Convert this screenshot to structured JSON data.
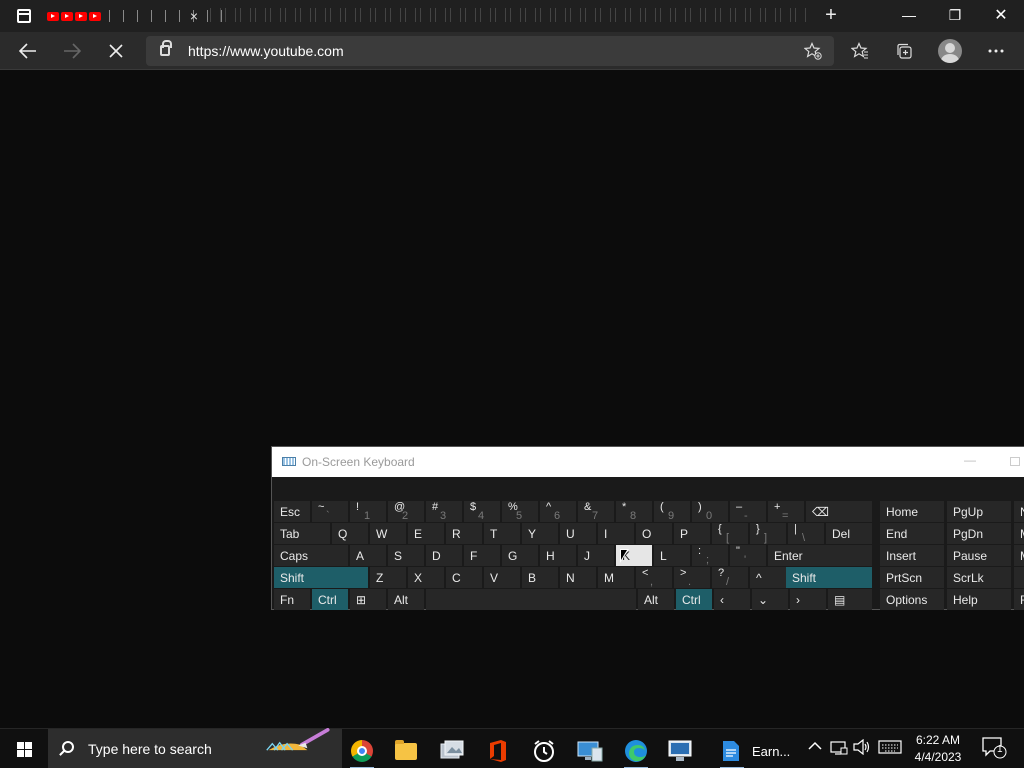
{
  "browser": {
    "url": "https://www.youtube.com",
    "tab_close_glyph": "×",
    "new_tab_glyph": "+",
    "icons": [
      "tab-actions-icon",
      "youtube-icon",
      "close-icon",
      "plus-icon",
      "back-icon",
      "forward-icon",
      "stop-loading-icon",
      "lock-icon",
      "add-favorite-icon",
      "favorites-icon",
      "collections-icon",
      "profile-avatar",
      "more-icon"
    ]
  },
  "window_controls": {
    "minimize": "—",
    "restore": "❐",
    "close": "✕"
  },
  "osk": {
    "title": "On-Screen Keyboard",
    "rows": [
      [
        {
          "id": "esc",
          "label": "Esc"
        },
        {
          "id": "tilde",
          "top": "~",
          "bot": "`"
        },
        {
          "id": "1",
          "top": "!",
          "bot": "1"
        },
        {
          "id": "2",
          "top": "@",
          "bot": "2"
        },
        {
          "id": "3",
          "top": "#",
          "bot": "3"
        },
        {
          "id": "4",
          "top": "$",
          "bot": "4"
        },
        {
          "id": "5",
          "top": "%",
          "bot": "5"
        },
        {
          "id": "6",
          "top": "^",
          "bot": "6"
        },
        {
          "id": "7",
          "top": "&",
          "bot": "7"
        },
        {
          "id": "8",
          "top": "*",
          "bot": "8"
        },
        {
          "id": "9",
          "top": "(",
          "bot": "9"
        },
        {
          "id": "0",
          "top": ")",
          "bot": "0"
        },
        {
          "id": "minus",
          "top": "–",
          "bot": "-"
        },
        {
          "id": "equals",
          "top": "+",
          "bot": "="
        },
        {
          "id": "backspace",
          "label": "⌫"
        }
      ],
      [
        {
          "id": "tab",
          "label": "Tab"
        },
        {
          "id": "q",
          "label": "Q"
        },
        {
          "id": "w",
          "label": "W"
        },
        {
          "id": "e",
          "label": "E"
        },
        {
          "id": "r",
          "label": "R"
        },
        {
          "id": "t",
          "label": "T"
        },
        {
          "id": "y",
          "label": "Y"
        },
        {
          "id": "u",
          "label": "U"
        },
        {
          "id": "i",
          "label": "I"
        },
        {
          "id": "o",
          "label": "O"
        },
        {
          "id": "p",
          "label": "P"
        },
        {
          "id": "lbrace",
          "top": "{",
          "bot": "["
        },
        {
          "id": "rbrace",
          "top": "}",
          "bot": "]"
        },
        {
          "id": "pipe",
          "top": "|",
          "bot": "\\"
        },
        {
          "id": "del",
          "label": "Del"
        }
      ],
      [
        {
          "id": "caps",
          "label": "Caps"
        },
        {
          "id": "a",
          "label": "A"
        },
        {
          "id": "s",
          "label": "S"
        },
        {
          "id": "d",
          "label": "D"
        },
        {
          "id": "f",
          "label": "F"
        },
        {
          "id": "g",
          "label": "G"
        },
        {
          "id": "h",
          "label": "H"
        },
        {
          "id": "j",
          "label": "J"
        },
        {
          "id": "k",
          "label": "K"
        },
        {
          "id": "l",
          "label": "L"
        },
        {
          "id": "colon",
          "top": ":",
          "bot": ";"
        },
        {
          "id": "quote",
          "top": "\"",
          "bot": "'"
        },
        {
          "id": "enter",
          "label": "Enter"
        }
      ],
      [
        {
          "id": "shift-left",
          "label": "Shift"
        },
        {
          "id": "z",
          "label": "Z"
        },
        {
          "id": "x",
          "label": "X"
        },
        {
          "id": "c",
          "label": "C"
        },
        {
          "id": "v",
          "label": "V"
        },
        {
          "id": "b",
          "label": "B"
        },
        {
          "id": "n",
          "label": "N"
        },
        {
          "id": "m",
          "label": "M"
        },
        {
          "id": "comma",
          "top": "<",
          "bot": ","
        },
        {
          "id": "period",
          "top": ">",
          "bot": "."
        },
        {
          "id": "slash",
          "top": "?",
          "bot": "/"
        },
        {
          "id": "up",
          "label": "^"
        },
        {
          "id": "shift-right",
          "label": "Shift"
        }
      ],
      [
        {
          "id": "fn",
          "label": "Fn"
        },
        {
          "id": "ctrl-left",
          "label": "Ctrl"
        },
        {
          "id": "win",
          "label": "⊞"
        },
        {
          "id": "alt-left",
          "label": "Alt"
        },
        {
          "id": "space",
          "label": ""
        },
        {
          "id": "alt-right",
          "label": "Alt"
        },
        {
          "id": "ctrl-right",
          "label": "Ctrl"
        },
        {
          "id": "left",
          "label": "‹"
        },
        {
          "id": "down",
          "label": "⌄"
        },
        {
          "id": "right",
          "label": "›"
        },
        {
          "id": "menu",
          "label": "▤"
        }
      ]
    ],
    "nav_keys": [
      [
        "Home",
        "PgUp",
        "N"
      ],
      [
        "End",
        "PgDn",
        "M"
      ],
      [
        "Insert",
        "Pause",
        "M"
      ],
      [
        "PrtScn",
        "ScrLk",
        ""
      ],
      [
        "Options",
        "Help",
        "F"
      ]
    ],
    "highlighted_keys": [
      "shift-left",
      "shift-right",
      "ctrl-left",
      "ctrl-right"
    ],
    "hover_key": "k"
  },
  "taskbar": {
    "search_placeholder": "Type here to search",
    "apps": [
      "chrome",
      "file-explorer",
      "photos-viewer",
      "office",
      "alarms-clock",
      "desktop-connect",
      "edge",
      "remote-desktop",
      "notes"
    ],
    "notes_label": "Earn...",
    "time": "6:22 AM",
    "date": "4/4/2023",
    "notification_count": "1"
  },
  "colors": {
    "accent_teal": "#1e5e68",
    "youtube_red": "#ff0000",
    "page_bg": "#0c0c0c"
  }
}
